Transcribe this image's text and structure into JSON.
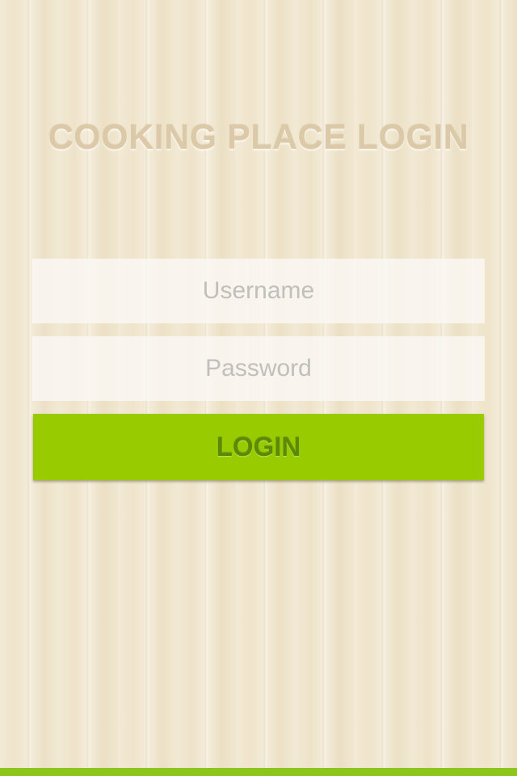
{
  "login": {
    "title": "COOKING PLACE LOGIN",
    "username": {
      "value": "",
      "placeholder": "Username"
    },
    "password": {
      "value": "",
      "placeholder": "Password"
    },
    "login_button_label": "LOGIN"
  },
  "colors": {
    "title": "#dcc9a7",
    "button_background": "#99cc00",
    "button_text": "#5c8a06",
    "bottom_bar": "#8cc51c",
    "field_background": "#faf8f4"
  }
}
